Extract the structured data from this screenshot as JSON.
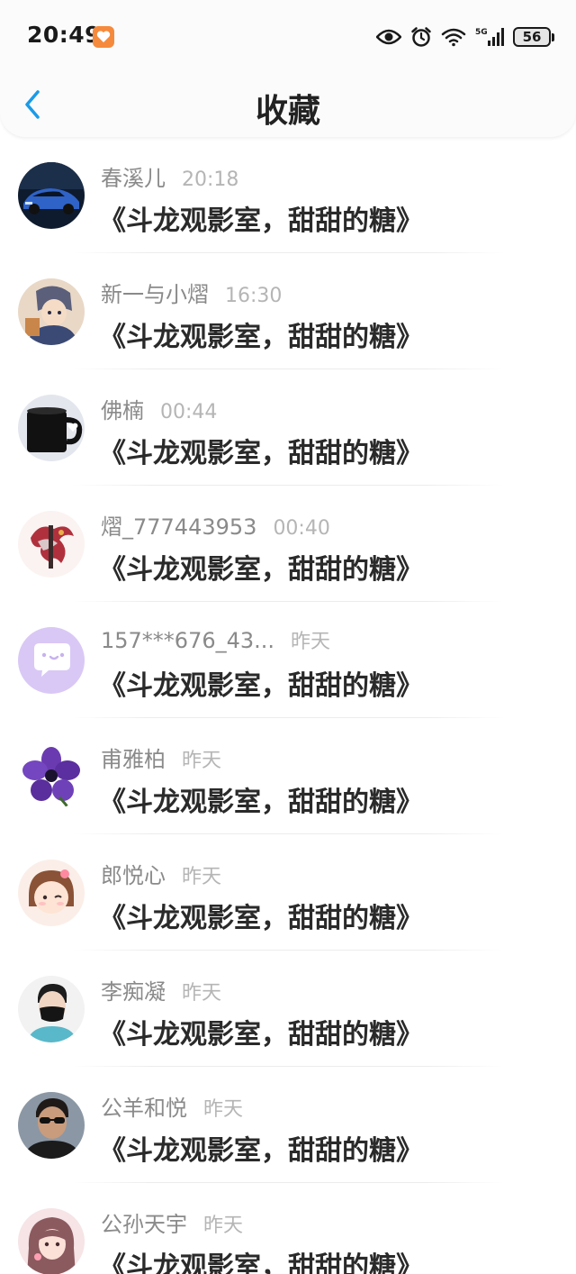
{
  "status_bar": {
    "time": "20:49",
    "network": "5G",
    "battery": "56",
    "icons": [
      "eye-icon",
      "alarm-icon",
      "wifi-icon",
      "signal-icon",
      "battery-icon"
    ]
  },
  "header": {
    "title": "收藏",
    "back_icon": "chevron-left-icon"
  },
  "colors": {
    "accent": "#1a9be8",
    "text_primary": "#2a2a2a",
    "text_secondary": "#8a8a8a",
    "text_time": "#b5b5b5"
  },
  "favorites": [
    {
      "sender": "春溪儿",
      "time": "20:18",
      "content": "《斗龙观影室，甜甜的糖》",
      "avatar": "car-avatar"
    },
    {
      "sender": "新一与小熠",
      "time": "16:30",
      "content": "《斗龙观影室，甜甜的糖》",
      "avatar": "anime-avatar"
    },
    {
      "sender": "佛楠",
      "time": "00:44",
      "content": "《斗龙观影室，甜甜的糖》",
      "avatar": "mug-avatar"
    },
    {
      "sender": "熠_777443953",
      "time": "00:40",
      "content": "《斗龙观影室，甜甜的糖》",
      "avatar": "dragon-avatar"
    },
    {
      "sender": "157***676_43...",
      "time": "昨天",
      "content": "《斗龙观影室，甜甜的糖》",
      "avatar": "chat-bubble-avatar"
    },
    {
      "sender": "甫雅柏",
      "time": "昨天",
      "content": "《斗龙观影室，甜甜的糖》",
      "avatar": "flower-avatar"
    },
    {
      "sender": "郎悦心",
      "time": "昨天",
      "content": "《斗龙观影室，甜甜的糖》",
      "avatar": "cartoon-girl-avatar"
    },
    {
      "sender": "李痴凝",
      "time": "昨天",
      "content": "《斗龙观影室，甜甜的糖》",
      "avatar": "masked-man-avatar"
    },
    {
      "sender": "公羊和悦",
      "time": "昨天",
      "content": "《斗龙观影室，甜甜的糖》",
      "avatar": "sunglasses-man-avatar"
    },
    {
      "sender": "公孙天宇",
      "time": "昨天",
      "content": "《斗龙观影室，甜甜的糖》",
      "avatar": "anime-girl-avatar"
    }
  ]
}
